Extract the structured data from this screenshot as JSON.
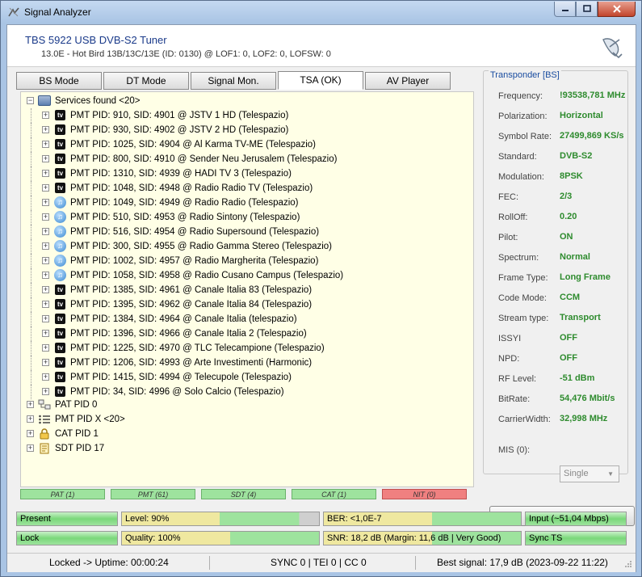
{
  "window": {
    "title": "Signal Analyzer"
  },
  "header": {
    "device_name": "TBS 5922 USB DVB-S2 Tuner",
    "device_info": "13.0E - Hot Bird 13B/13C/13E (ID: 0130) @ LOF1: 0, LOF2: 0, LOFSW: 0"
  },
  "tabs": [
    {
      "label": "BS Mode"
    },
    {
      "label": "DT Mode"
    },
    {
      "label": "Signal Mon."
    },
    {
      "label": "TSA (OK)",
      "active": true
    },
    {
      "label": "AV Player"
    }
  ],
  "tree": {
    "root_label": "Services found <20>",
    "services": [
      {
        "type": "tv",
        "label": "PMT PID: 910, SID: 4901 @ JSTV 1 HD (Telespazio)"
      },
      {
        "type": "tv",
        "label": "PMT PID: 930, SID: 4902 @ JSTV 2 HD (Telespazio)"
      },
      {
        "type": "tv",
        "label": "PMT PID: 1025, SID: 4904 @ Al Karma TV-ME (Telespazio)"
      },
      {
        "type": "tv",
        "label": "PMT PID: 800, SID: 4910 @ Sender Neu Jerusalem (Telespazio)"
      },
      {
        "type": "tv",
        "label": "PMT PID: 1310, SID: 4939 @ HADI TV 3 (Telespazio)"
      },
      {
        "type": "tv",
        "label": "PMT PID: 1048, SID: 4948 @ Radio Radio TV (Telespazio)"
      },
      {
        "type": "radio",
        "label": "PMT PID: 1049, SID: 4949 @ Radio Radio (Telespazio)"
      },
      {
        "type": "radio",
        "label": "PMT PID: 510, SID: 4953 @ Radio Sintony (Telespazio)"
      },
      {
        "type": "radio",
        "label": "PMT PID: 516, SID: 4954 @ Radio Supersound (Telespazio)"
      },
      {
        "type": "radio",
        "label": "PMT PID: 300, SID: 4955 @ Radio Gamma Stereo (Telespazio)"
      },
      {
        "type": "radio",
        "label": "PMT PID: 1002, SID: 4957 @ Radio Margherita (Telespazio)"
      },
      {
        "type": "radio",
        "label": "PMT PID: 1058, SID: 4958 @ Radio Cusano Campus (Telespazio)"
      },
      {
        "type": "tv",
        "label": "PMT PID: 1385, SID: 4961 @ Canale Italia 83 (Telespazio)"
      },
      {
        "type": "tv",
        "label": "PMT PID: 1395, SID: 4962 @ Canale Italia 84 (Telespazio)"
      },
      {
        "type": "tv",
        "label": "PMT PID: 1384, SID: 4964 @ Canale Italia (telespazio)"
      },
      {
        "type": "tv",
        "label": "PMT PID: 1396, SID: 4966 @ Canale Italia 2 (Telespazio)"
      },
      {
        "type": "tv",
        "label": "PMT PID: 1225, SID: 4970 @ TLC Telecampione (Telespazio)"
      },
      {
        "type": "tv",
        "label": "PMT PID: 1206, SID: 4993 @ Arte Investimenti (Harmonic)"
      },
      {
        "type": "tv",
        "label": "PMT PID: 1415, SID: 4994 @ Telecupole (Telespazio)"
      },
      {
        "type": "tv",
        "label": "PMT PID: 34, SID: 4996 @ Solo Calcio (Telespazio)"
      }
    ],
    "other_nodes": [
      {
        "icon": "pat-icon",
        "label": "PAT PID 0"
      },
      {
        "icon": "list-icon",
        "label": "PMT PID X <20>"
      },
      {
        "icon": "lock-icon",
        "label": "CAT PID 1"
      },
      {
        "icon": "document-icon",
        "label": "SDT PID 17"
      }
    ]
  },
  "table_status": [
    {
      "label": "PAT (1)",
      "color": "#9ee39e"
    },
    {
      "label": "PMT (61)",
      "color": "#9ee39e"
    },
    {
      "label": "SDT (4)",
      "color": "#9ee39e"
    },
    {
      "label": "CAT (1)",
      "color": "#9ee39e"
    },
    {
      "label": "NIT (0)",
      "color": "#f08080"
    }
  ],
  "transponder": {
    "title": "Transponder [BS]",
    "properties": [
      {
        "label": "Frequency:",
        "value": "!93538,781 MHz"
      },
      {
        "label": "Polarization:",
        "value": "Horizontal"
      },
      {
        "label": "Symbol Rate:",
        "value": "27499,869 KS/s"
      },
      {
        "label": "Standard:",
        "value": "DVB-S2"
      },
      {
        "label": "Modulation:",
        "value": "8PSK"
      },
      {
        "label": "FEC:",
        "value": "2/3"
      },
      {
        "label": "RollOff:",
        "value": "0.20"
      },
      {
        "label": "Pilot:",
        "value": "ON"
      },
      {
        "label": "Spectrum:",
        "value": "Normal"
      },
      {
        "label": "Frame Type:",
        "value": "Long Frame"
      },
      {
        "label": "Code Mode:",
        "value": "CCM"
      },
      {
        "label": "Stream type:",
        "value": "Transport"
      },
      {
        "label": "ISSYI",
        "value": "OFF"
      },
      {
        "label": "NPD:",
        "value": "OFF"
      },
      {
        "label": "RF Level:",
        "value": "-51 dBm"
      },
      {
        "label": "BitRate:",
        "value": "54,476 Mbit/s"
      },
      {
        "label": "CarrierWidth:",
        "value": "32,998 MHz"
      }
    ],
    "mis_label": "MIS (0):",
    "mis_value": "Single"
  },
  "meters": {
    "present": "Present",
    "lock": "Lock",
    "level": "Level: 90%",
    "level_value": 0.9,
    "quality": "Quality: 100%",
    "quality_value": 1.0,
    "ber": "BER: <1,0E-7",
    "snr": "SNR: 18,2 dB (Margin: 11,6 dB | Very Good)",
    "input": "Input (~51,04 Mbps)",
    "sync_ts": "Sync TS"
  },
  "statusbar": {
    "lock_status": "Locked -> Uptime: 00:00:24",
    "sync": "SYNC 0 | TEI 0 | CC 0",
    "best_signal": "Best signal: 17,9 dB (2023-09-22 11:22)"
  }
}
